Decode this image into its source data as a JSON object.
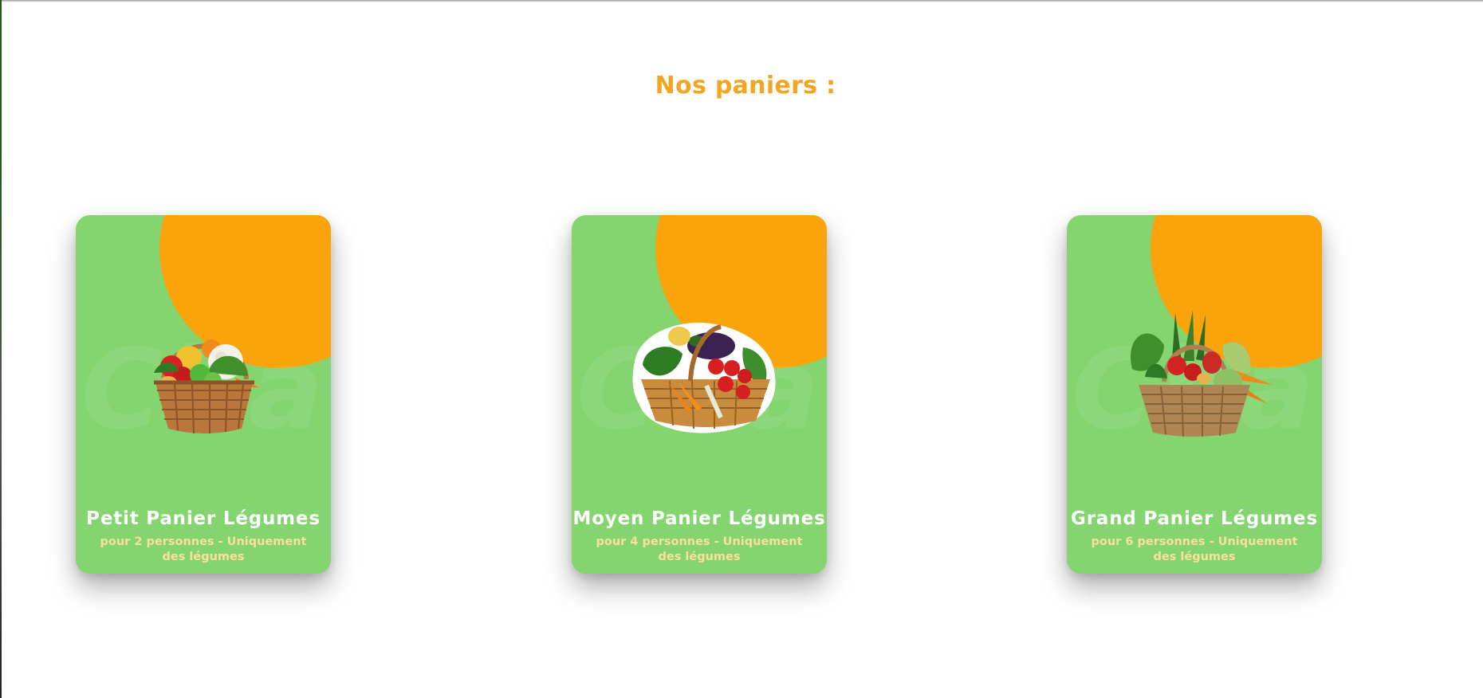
{
  "section": {
    "title": "Nos paniers :"
  },
  "cards": [
    {
      "title": "Petit Panier Légumes",
      "description": "pour 2 personnes - Uniquement des légumes",
      "image_icon": "vegetable-basket-small-icon"
    },
    {
      "title": "Moyen Panier Légumes",
      "description": "pour 4 personnes - Uniquement des légumes",
      "image_icon": "vegetable-basket-medium-icon"
    },
    {
      "title": "Grand Panier Légumes",
      "description": "pour 6 personnes - Uniquement des légumes",
      "image_icon": "vegetable-basket-large-icon"
    }
  ],
  "colors": {
    "title": "#f3a420",
    "card_background": "#84d46f",
    "card_circle": "#fba30b",
    "card_title": "#ffffff",
    "card_description": "#fbe09a"
  }
}
